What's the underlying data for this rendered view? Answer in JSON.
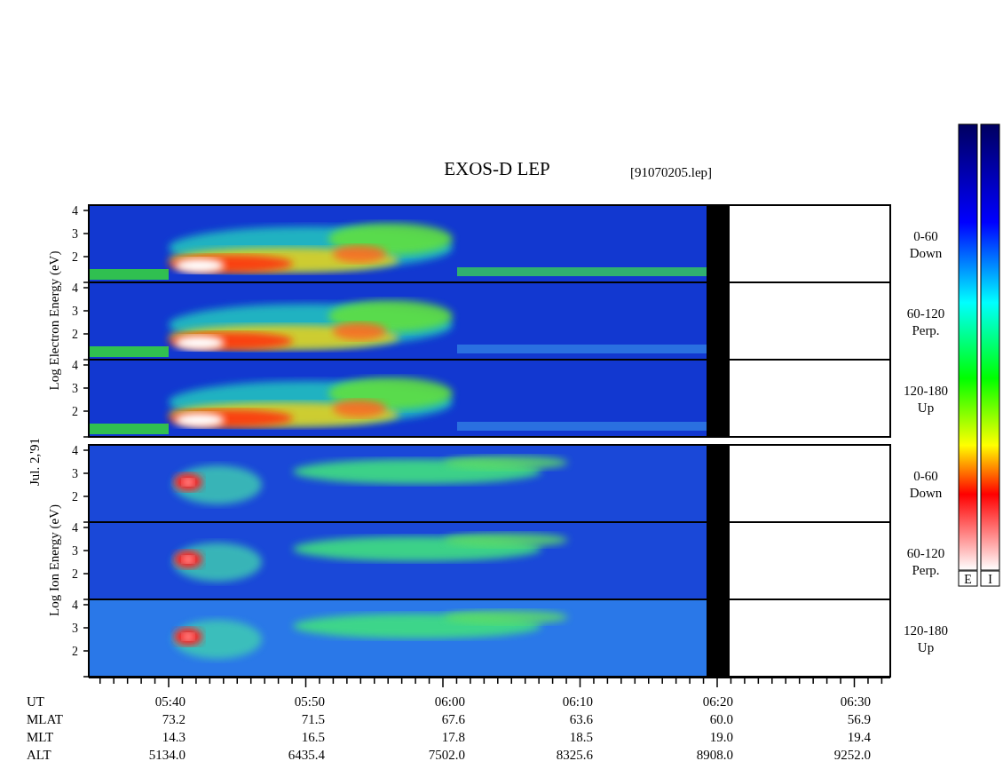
{
  "title": "EXOS-D LEP",
  "file_label": "[91070205.lep]",
  "electron_axis_label": "Log Electron Energy (eV)",
  "date_label": "Jul. 2,'91",
  "ion_axis_label": "Log Ion Energy (eV)",
  "panels": [
    {
      "kind": "electron",
      "angle": "0-60",
      "direction": "Down",
      "ticks": [
        "4",
        "3",
        "2"
      ]
    },
    {
      "kind": "electron",
      "angle": "60-120",
      "direction": "Perp.",
      "ticks": [
        "4",
        "3",
        "2"
      ]
    },
    {
      "kind": "electron",
      "angle": "120-180",
      "direction": "Up",
      "ticks": [
        "4",
        "3",
        "2"
      ]
    },
    {
      "kind": "ion",
      "angle": "0-60",
      "direction": "Down",
      "ticks": [
        "4",
        "3",
        "2"
      ]
    },
    {
      "kind": "ion",
      "angle": "60-120",
      "direction": "Perp.",
      "ticks": [
        "4",
        "3",
        "2"
      ]
    },
    {
      "kind": "ion",
      "angle": "120-180",
      "direction": "Up",
      "ticks": [
        "4",
        "3",
        "2"
      ]
    }
  ],
  "colorbars": [
    "E",
    "I"
  ],
  "rows": [
    {
      "label": "UT",
      "values": [
        "05:40",
        "05:50",
        "06:00",
        "06:10",
        "06:20",
        "06:30"
      ]
    },
    {
      "label": "MLAT",
      "values": [
        "73.2",
        "71.5",
        "67.6",
        "63.6",
        "60.0",
        "56.9"
      ]
    },
    {
      "label": "MLT",
      "values": [
        "14.3",
        "16.5",
        "17.8",
        "18.5",
        "19.0",
        "19.4"
      ]
    },
    {
      "label": "ALT",
      "values": [
        "5134.0",
        "6435.4",
        "7502.0",
        "8325.6",
        "8908.0",
        "9252.0"
      ]
    }
  ]
}
